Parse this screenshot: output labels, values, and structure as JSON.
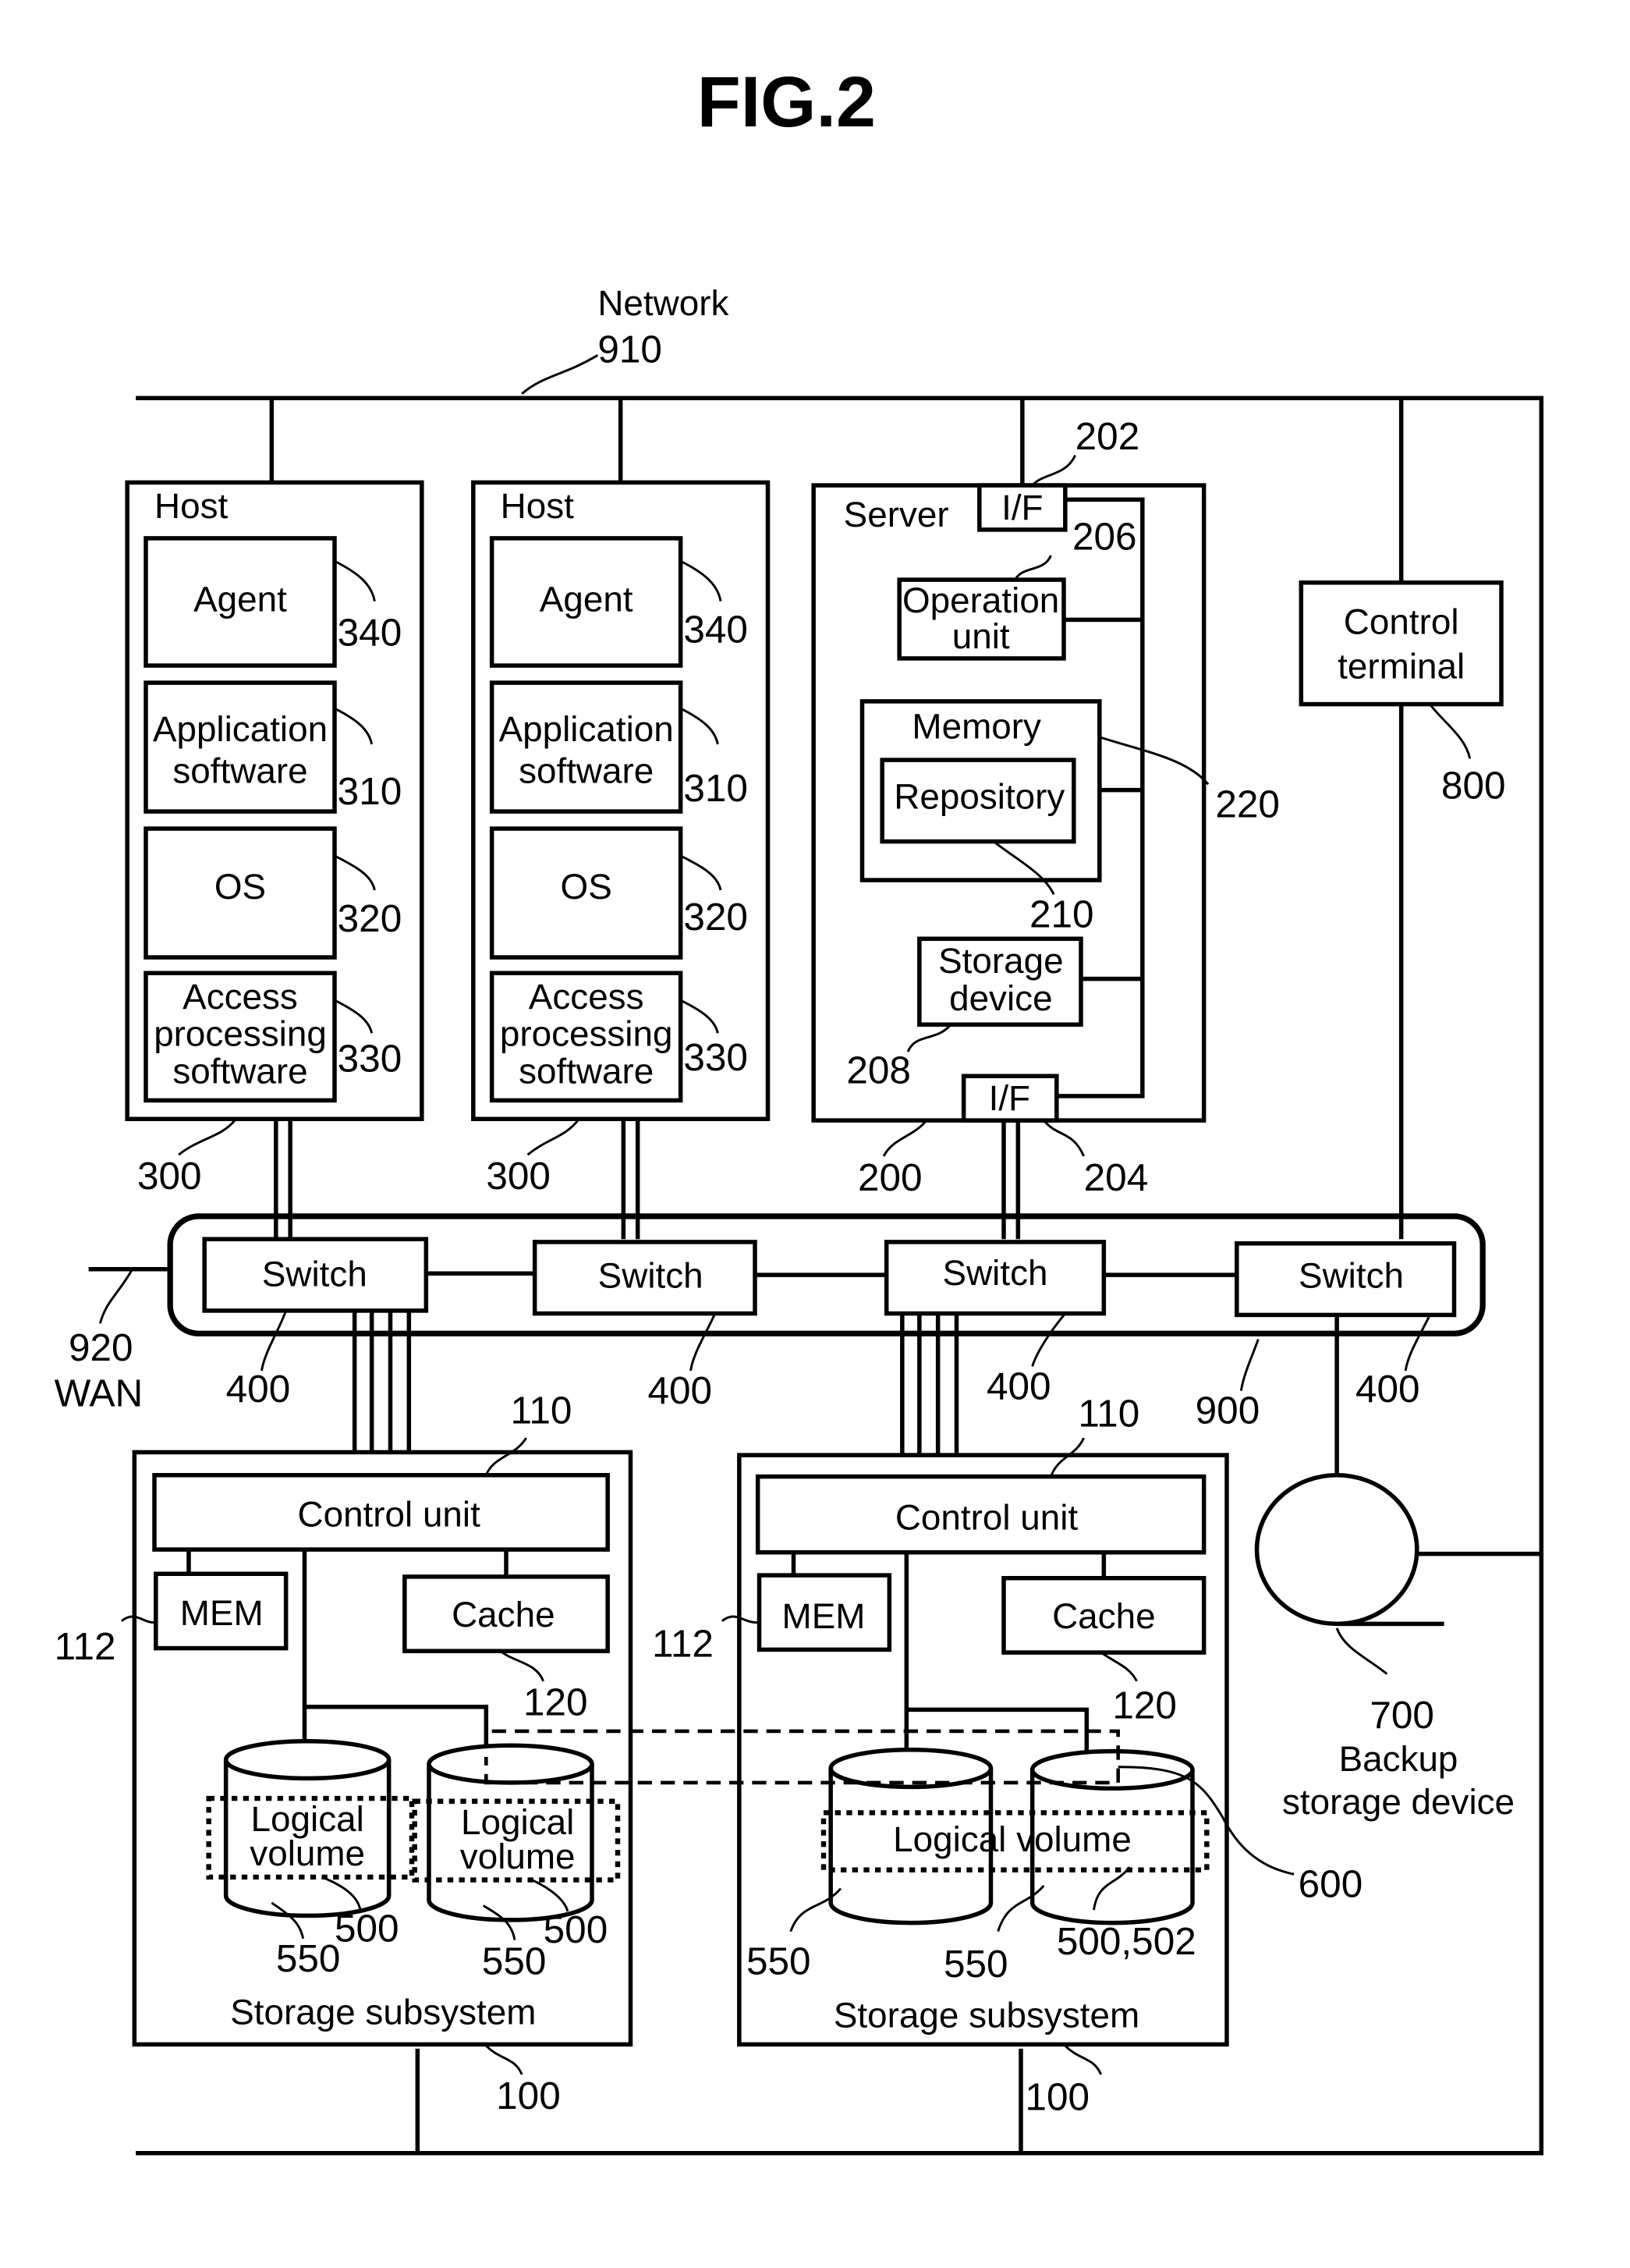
{
  "figure": {
    "title": "FIG.2",
    "network": {
      "label": "Network",
      "ref": "910"
    },
    "wan": {
      "label": "WAN",
      "ref": "920"
    },
    "hosts": [
      {
        "label": "Host",
        "ref": "300",
        "components": [
          {
            "label_lines": [
              "Agent"
            ],
            "ref": "340"
          },
          {
            "label_lines": [
              "Application",
              "software"
            ],
            "ref": "310"
          },
          {
            "label_lines": [
              "OS"
            ],
            "ref": "320"
          },
          {
            "label_lines": [
              "Access",
              "processing",
              "software"
            ],
            "ref": "330"
          }
        ]
      },
      {
        "label": "Host",
        "ref": "300",
        "components": [
          {
            "label_lines": [
              "Agent"
            ],
            "ref": "340"
          },
          {
            "label_lines": [
              "Application",
              "software"
            ],
            "ref": "310"
          },
          {
            "label_lines": [
              "OS"
            ],
            "ref": "320"
          },
          {
            "label_lines": [
              "Access",
              "processing",
              "software"
            ],
            "ref": "330"
          }
        ]
      }
    ],
    "server": {
      "label": "Server",
      "ref": "200",
      "if_top": {
        "label": "I/F",
        "ref": "202"
      },
      "if_bottom": {
        "label": "I/F",
        "ref": "204"
      },
      "operation_unit": {
        "label_lines": [
          "Operation",
          "unit"
        ],
        "ref": "206"
      },
      "memory": {
        "label": "Memory",
        "ref": "220"
      },
      "repository": {
        "label": "Repository",
        "ref": "210"
      },
      "storage_device": {
        "label_lines": [
          "Storage",
          "device"
        ],
        "ref": "208"
      }
    },
    "control_terminal": {
      "label_lines": [
        "Control",
        "terminal"
      ],
      "ref": "800"
    },
    "switch_network": {
      "ref": "900",
      "switches": [
        {
          "label": "Switch",
          "ref": "400"
        },
        {
          "label": "Switch",
          "ref": "400"
        },
        {
          "label": "Switch",
          "ref": "400"
        },
        {
          "label": "Switch",
          "ref": "400"
        }
      ]
    },
    "storage_subsystems": [
      {
        "label": "Storage subsystem",
        "ref": "100",
        "control_unit": {
          "label": "Control unit",
          "ref": "110"
        },
        "mem": {
          "label": "MEM",
          "ref": "112"
        },
        "cache": {
          "label": "Cache",
          "ref": "120"
        },
        "disks": [
          {
            "ref": "550"
          },
          {
            "ref": "550"
          }
        ],
        "volumes": [
          {
            "label_lines": [
              "Logical",
              "volume"
            ],
            "ref": "500"
          },
          {
            "label_lines": [
              "Logical",
              "volume"
            ],
            "ref": "500"
          }
        ]
      },
      {
        "label": "Storage subsystem",
        "ref": "100",
        "control_unit": {
          "label": "Control unit",
          "ref": "110"
        },
        "mem": {
          "label": "MEM",
          "ref": "112"
        },
        "cache": {
          "label": "Cache",
          "ref": "120"
        },
        "disks": [
          {
            "ref": "550"
          },
          {
            "ref": "550"
          }
        ],
        "volume": {
          "label": "Logical volume",
          "ref": "500,502"
        }
      }
    ],
    "pair_link": {
      "ref": "600"
    },
    "backup": {
      "ref": "700",
      "label_lines": [
        "Backup",
        "storage device"
      ]
    }
  }
}
